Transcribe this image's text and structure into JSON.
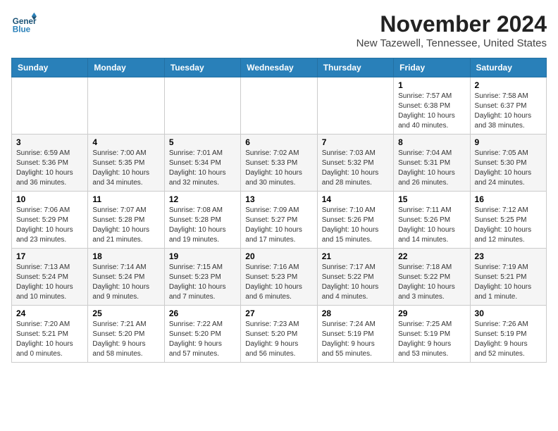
{
  "logo": {
    "line1": "General",
    "line2": "Blue"
  },
  "title": "November 2024",
  "location": "New Tazewell, Tennessee, United States",
  "weekdays": [
    "Sunday",
    "Monday",
    "Tuesday",
    "Wednesday",
    "Thursday",
    "Friday",
    "Saturday"
  ],
  "weeks": [
    [
      {
        "day": "",
        "info": ""
      },
      {
        "day": "",
        "info": ""
      },
      {
        "day": "",
        "info": ""
      },
      {
        "day": "",
        "info": ""
      },
      {
        "day": "",
        "info": ""
      },
      {
        "day": "1",
        "info": "Sunrise: 7:57 AM\nSunset: 6:38 PM\nDaylight: 10 hours\nand 40 minutes."
      },
      {
        "day": "2",
        "info": "Sunrise: 7:58 AM\nSunset: 6:37 PM\nDaylight: 10 hours\nand 38 minutes."
      }
    ],
    [
      {
        "day": "3",
        "info": "Sunrise: 6:59 AM\nSunset: 5:36 PM\nDaylight: 10 hours\nand 36 minutes."
      },
      {
        "day": "4",
        "info": "Sunrise: 7:00 AM\nSunset: 5:35 PM\nDaylight: 10 hours\nand 34 minutes."
      },
      {
        "day": "5",
        "info": "Sunrise: 7:01 AM\nSunset: 5:34 PM\nDaylight: 10 hours\nand 32 minutes."
      },
      {
        "day": "6",
        "info": "Sunrise: 7:02 AM\nSunset: 5:33 PM\nDaylight: 10 hours\nand 30 minutes."
      },
      {
        "day": "7",
        "info": "Sunrise: 7:03 AM\nSunset: 5:32 PM\nDaylight: 10 hours\nand 28 minutes."
      },
      {
        "day": "8",
        "info": "Sunrise: 7:04 AM\nSunset: 5:31 PM\nDaylight: 10 hours\nand 26 minutes."
      },
      {
        "day": "9",
        "info": "Sunrise: 7:05 AM\nSunset: 5:30 PM\nDaylight: 10 hours\nand 24 minutes."
      }
    ],
    [
      {
        "day": "10",
        "info": "Sunrise: 7:06 AM\nSunset: 5:29 PM\nDaylight: 10 hours\nand 23 minutes."
      },
      {
        "day": "11",
        "info": "Sunrise: 7:07 AM\nSunset: 5:28 PM\nDaylight: 10 hours\nand 21 minutes."
      },
      {
        "day": "12",
        "info": "Sunrise: 7:08 AM\nSunset: 5:28 PM\nDaylight: 10 hours\nand 19 minutes."
      },
      {
        "day": "13",
        "info": "Sunrise: 7:09 AM\nSunset: 5:27 PM\nDaylight: 10 hours\nand 17 minutes."
      },
      {
        "day": "14",
        "info": "Sunrise: 7:10 AM\nSunset: 5:26 PM\nDaylight: 10 hours\nand 15 minutes."
      },
      {
        "day": "15",
        "info": "Sunrise: 7:11 AM\nSunset: 5:26 PM\nDaylight: 10 hours\nand 14 minutes."
      },
      {
        "day": "16",
        "info": "Sunrise: 7:12 AM\nSunset: 5:25 PM\nDaylight: 10 hours\nand 12 minutes."
      }
    ],
    [
      {
        "day": "17",
        "info": "Sunrise: 7:13 AM\nSunset: 5:24 PM\nDaylight: 10 hours\nand 10 minutes."
      },
      {
        "day": "18",
        "info": "Sunrise: 7:14 AM\nSunset: 5:24 PM\nDaylight: 10 hours\nand 9 minutes."
      },
      {
        "day": "19",
        "info": "Sunrise: 7:15 AM\nSunset: 5:23 PM\nDaylight: 10 hours\nand 7 minutes."
      },
      {
        "day": "20",
        "info": "Sunrise: 7:16 AM\nSunset: 5:23 PM\nDaylight: 10 hours\nand 6 minutes."
      },
      {
        "day": "21",
        "info": "Sunrise: 7:17 AM\nSunset: 5:22 PM\nDaylight: 10 hours\nand 4 minutes."
      },
      {
        "day": "22",
        "info": "Sunrise: 7:18 AM\nSunset: 5:22 PM\nDaylight: 10 hours\nand 3 minutes."
      },
      {
        "day": "23",
        "info": "Sunrise: 7:19 AM\nSunset: 5:21 PM\nDaylight: 10 hours\nand 1 minute."
      }
    ],
    [
      {
        "day": "24",
        "info": "Sunrise: 7:20 AM\nSunset: 5:21 PM\nDaylight: 10 hours\nand 0 minutes."
      },
      {
        "day": "25",
        "info": "Sunrise: 7:21 AM\nSunset: 5:20 PM\nDaylight: 9 hours\nand 58 minutes."
      },
      {
        "day": "26",
        "info": "Sunrise: 7:22 AM\nSunset: 5:20 PM\nDaylight: 9 hours\nand 57 minutes."
      },
      {
        "day": "27",
        "info": "Sunrise: 7:23 AM\nSunset: 5:20 PM\nDaylight: 9 hours\nand 56 minutes."
      },
      {
        "day": "28",
        "info": "Sunrise: 7:24 AM\nSunset: 5:19 PM\nDaylight: 9 hours\nand 55 minutes."
      },
      {
        "day": "29",
        "info": "Sunrise: 7:25 AM\nSunset: 5:19 PM\nDaylight: 9 hours\nand 53 minutes."
      },
      {
        "day": "30",
        "info": "Sunrise: 7:26 AM\nSunset: 5:19 PM\nDaylight: 9 hours\nand 52 minutes."
      }
    ]
  ]
}
